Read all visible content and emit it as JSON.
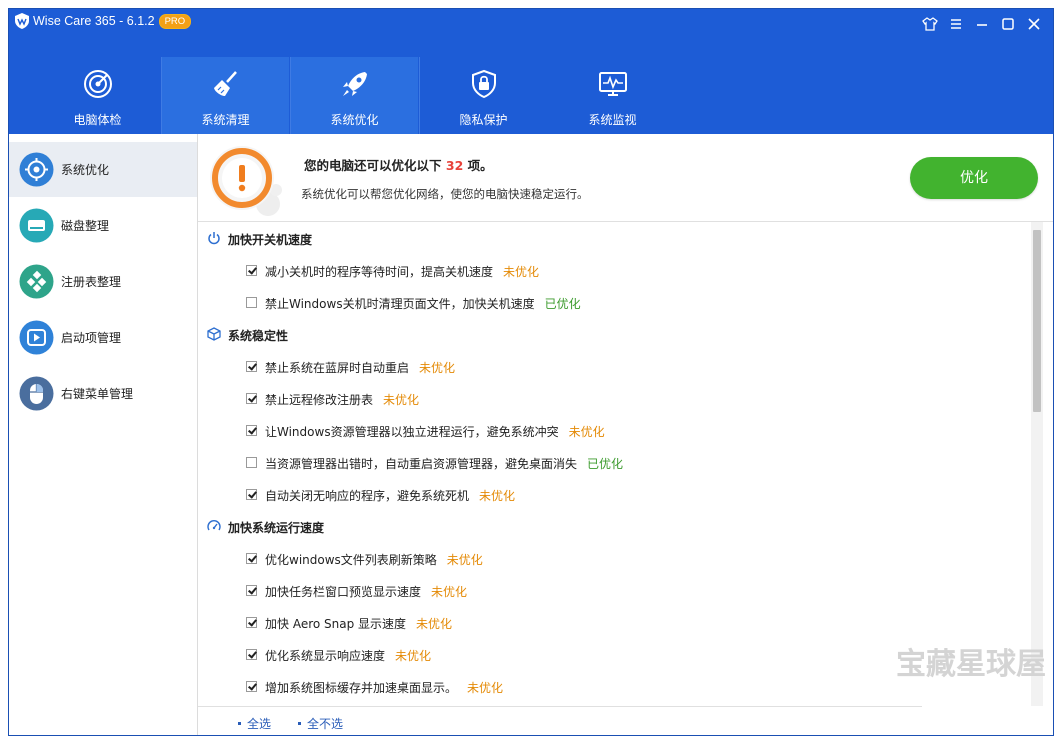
{
  "window": {
    "title": "Wise Care 365 - 6.1.2",
    "badge": "PRO",
    "controls": [
      "shirt-icon",
      "menu-icon",
      "minimize-icon",
      "maximize-icon",
      "close-icon"
    ]
  },
  "nav": {
    "tabs": [
      {
        "label": "电脑体检",
        "icon": "radar-icon",
        "active": false
      },
      {
        "label": "系统清理",
        "icon": "broom-icon",
        "active": true
      },
      {
        "label": "系统优化",
        "icon": "rocket-icon",
        "active": false
      },
      {
        "label": "隐私保护",
        "icon": "lock-icon",
        "active": false
      },
      {
        "label": "系统监视",
        "icon": "monitor-icon",
        "active": false
      }
    ]
  },
  "sidebar": {
    "items": [
      {
        "label": "系统优化",
        "icon": "gauge-icon",
        "active": true
      },
      {
        "label": "磁盘整理",
        "icon": "disk-icon",
        "active": false
      },
      {
        "label": "注册表整理",
        "icon": "registry-icon",
        "active": false
      },
      {
        "label": "启动项管理",
        "icon": "play-icon",
        "active": false
      },
      {
        "label": "右键菜单管理",
        "icon": "mouse-icon",
        "active": false
      }
    ]
  },
  "banner": {
    "title_prefix": "您的电脑还可以优化以下",
    "count": "32",
    "title_suffix": "项。",
    "subtitle": "系统优化可以帮您优化网络，使您的电脑快速稳定运行。",
    "button": "优化"
  },
  "groups": [
    {
      "title": "加快开关机速度",
      "icon": "power-icon",
      "items": [
        {
          "text": "减小关机时的程序等待时间，提高关机速度",
          "status": "未优化",
          "checked": true
        },
        {
          "text": "禁止Windows关机时清理页面文件，加快关机速度",
          "status": "已优化",
          "checked": false
        }
      ]
    },
    {
      "title": "系统稳定性",
      "icon": "cube-icon",
      "items": [
        {
          "text": "禁止系统在蓝屏时自动重启",
          "status": "未优化",
          "checked": true
        },
        {
          "text": "禁止远程修改注册表",
          "status": "未优化",
          "checked": true
        },
        {
          "text": "让Windows资源管理器以独立进程运行，避免系统冲突",
          "status": "未优化",
          "checked": true
        },
        {
          "text": "当资源管理器出错时，自动重启资源管理器，避免桌面消失",
          "status": "已优化",
          "checked": false
        },
        {
          "text": "自动关闭无响应的程序，避免系统死机",
          "status": "未优化",
          "checked": true
        }
      ]
    },
    {
      "title": "加快系统运行速度",
      "icon": "speedometer-icon",
      "items": [
        {
          "text": "优化windows文件列表刷新策略",
          "status": "未优化",
          "checked": true
        },
        {
          "text": "加快任务栏窗口预览显示速度",
          "status": "未优化",
          "checked": true
        },
        {
          "text": "加快 Aero Snap 显示速度",
          "status": "未优化",
          "checked": true
        },
        {
          "text": "优化系统显示响应速度",
          "status": "未优化",
          "checked": true
        },
        {
          "text": "增加系统图标缓存并加速桌面显示。",
          "status": "未优化",
          "checked": true
        }
      ]
    }
  ],
  "footer": {
    "select_all": "全选",
    "select_none": "全不选"
  },
  "watermark": "宝藏星球屋",
  "colors": {
    "header": "#1d5cd6",
    "active_tab": "#2b6fe0",
    "optimize_button": "#42b32f",
    "not_optimized": "#e48a06",
    "optimized": "#3c9b2d",
    "count": "#e8423a"
  }
}
